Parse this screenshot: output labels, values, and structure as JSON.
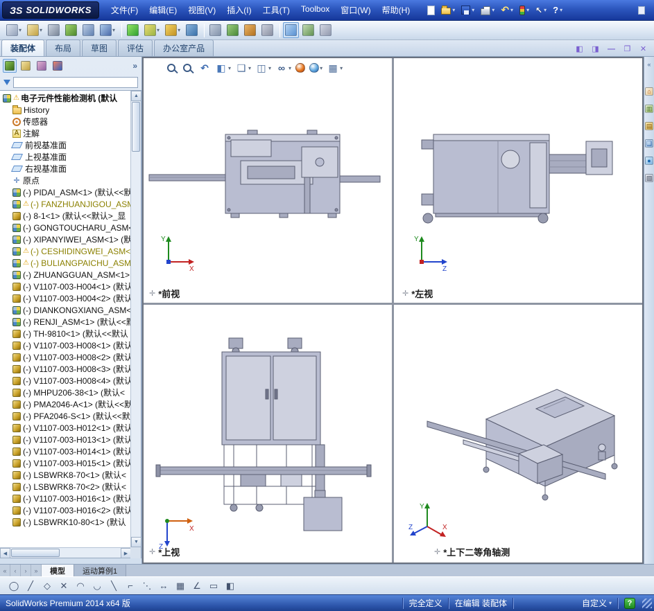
{
  "colors": {
    "accent": "#2f62c4",
    "olive": "#8b8000",
    "titlebar": "#2c56bd",
    "status_green": "#1e8a1e",
    "model_fill": "#b9bdd1",
    "model_stroke": "#5a5e72"
  },
  "icons": {
    "caret": "▾",
    "chevron": "»",
    "taskpane_chevron": "«",
    "view_axis_glyph": "✛",
    "annot_glyph": "A",
    "origin_glyph": "✛",
    "warning_glyph": "⚠",
    "up_arrow": "▲",
    "down_arrow": "▼",
    "left_arrow": "◀",
    "right_arrow": "▶"
  },
  "axes": {
    "x": "X",
    "y": "Y",
    "z": "Z"
  },
  "titlebar": {
    "logo_mark": "ЗS",
    "logo_text": "SOLIDWORKS",
    "menus": [
      {
        "id": "file",
        "label": "文件(F)"
      },
      {
        "id": "edit",
        "label": "编辑(E)"
      },
      {
        "id": "view",
        "label": "视图(V)"
      },
      {
        "id": "insert",
        "label": "插入(I)"
      },
      {
        "id": "tools",
        "label": "工具(T)"
      },
      {
        "id": "toolbox",
        "label": "Toolbox"
      },
      {
        "id": "window",
        "label": "窗口(W)"
      },
      {
        "id": "help",
        "label": "帮助(H)"
      }
    ],
    "quick_icons": [
      {
        "id": "new"
      },
      {
        "id": "open",
        "dropdown": true
      },
      {
        "id": "save",
        "dropdown": true
      },
      {
        "id": "print",
        "dropdown": true
      },
      {
        "id": "undo",
        "glyph": "↶",
        "dropdown": true
      },
      {
        "id": "rebuild",
        "dropdown": true
      },
      {
        "id": "select",
        "glyph": "↖",
        "dropdown": true
      },
      {
        "id": "help",
        "glyph": "?",
        "dropdown": true
      }
    ]
  },
  "toolbar": {
    "icons": [
      {
        "id": "insert-components",
        "c1": "#dce3ee",
        "c2": "#93a2ba",
        "dropdown": true
      },
      {
        "id": "mate",
        "c1": "#f2e4ac",
        "c2": "#c2a244",
        "dropdown": true
      },
      {
        "id": "smart-fasteners",
        "c1": "#ccd4e0",
        "c2": "#7a8698"
      },
      {
        "id": "linear-component-pattern",
        "c1": "#a4d46e",
        "c2": "#4e8a2e"
      },
      {
        "id": "move-component",
        "c1": "#bccce4",
        "c2": "#6282b2"
      },
      {
        "id": "rotate-component",
        "c1": "#accae9",
        "c2": "#4a6aaa",
        "dropdown": true
      },
      {
        "sep": true
      },
      {
        "id": "selection-filter",
        "c1": "#94e464",
        "c2": "#32a232"
      },
      {
        "id": "assembly-features",
        "c1": "#ecdc74",
        "c2": "#9ab444",
        "dropdown": true
      },
      {
        "id": "reference-geometry",
        "c1": "#f4d464",
        "c2": "#c29224",
        "dropdown": true
      },
      {
        "id": "instant3d",
        "c1": "#8cb4dc",
        "c2": "#3a72aa"
      },
      {
        "sep": true
      },
      {
        "id": "bill-of-materials",
        "c1": "#c4cedc",
        "c2": "#8292aa"
      },
      {
        "id": "exploded-view",
        "c1": "#9ccc7c",
        "c2": "#4a8a3a"
      },
      {
        "id": "interference-detection",
        "c1": "#ecb464",
        "c2": "#b27222"
      },
      {
        "id": "measure",
        "c1": "#ccd0dc",
        "c2": "#8a90a2"
      },
      {
        "sep": true
      },
      {
        "id": "viewport-layout",
        "c1": "#b2d2f2",
        "c2": "#5a92d2",
        "active": true
      },
      {
        "id": "display-settings",
        "c1": "#c2dab2",
        "c2": "#629252"
      },
      {
        "id": "section-tool",
        "c1": "#d2d6e2",
        "c2": "#929aae"
      }
    ]
  },
  "command_tabs": {
    "tabs": [
      {
        "id": "assembly",
        "label": "装配体",
        "active": true
      },
      {
        "id": "layout",
        "label": "布局"
      },
      {
        "id": "sketch",
        "label": "草图"
      },
      {
        "id": "evaluate",
        "label": "评估"
      },
      {
        "id": "office",
        "label": "办公室产品"
      }
    ],
    "window_controls": [
      {
        "id": "pane-left",
        "glyph": "◧"
      },
      {
        "id": "pane-right",
        "glyph": "◨"
      },
      {
        "id": "minimize-window",
        "glyph": "—"
      },
      {
        "id": "restore-window",
        "glyph": "❐"
      },
      {
        "id": "close-window",
        "glyph": "✕"
      }
    ]
  },
  "left_panel": {
    "filter_value": "",
    "manager_tabs": [
      {
        "id": "featuremanager",
        "c1": "#8cc454",
        "c2": "#3a6a1a",
        "active": true
      },
      {
        "id": "propertymanager",
        "c1": "#f2e2a2",
        "c2": "#c2a242"
      },
      {
        "id": "configurationmanager",
        "c1": "#e2b2d2",
        "c2": "#9262a2"
      },
      {
        "id": "displaymanager",
        "c1": "#f28262",
        "c2": "#3262c2"
      }
    ],
    "tree": [
      {
        "icon": "asm",
        "warn": true,
        "root": true,
        "label": "电子元件性能检测机 (默认"
      },
      {
        "icon": "folder",
        "label": "History"
      },
      {
        "icon": "sensor",
        "label": "传感器"
      },
      {
        "icon": "annot",
        "label": "注解"
      },
      {
        "icon": "plane",
        "label": "前视基准面"
      },
      {
        "icon": "plane",
        "label": "上视基准面"
      },
      {
        "icon": "plane",
        "label": "右视基准面"
      },
      {
        "icon": "origin",
        "label": "原点"
      },
      {
        "icon": "asm",
        "label": "(-) PIDAI_ASM<1> (默认<<默"
      },
      {
        "icon": "asm",
        "warn": true,
        "olive": true,
        "label": "(-) FANZHUANJIGOU_ASM"
      },
      {
        "icon": "part",
        "label": "(-) 8-1<1> (默认<<默认>_显"
      },
      {
        "icon": "asm",
        "label": "(-) GONGTOUCHARU_ASM<1"
      },
      {
        "icon": "asm",
        "label": "(-) XIPANYIWEI_ASM<1> (默"
      },
      {
        "icon": "asm",
        "warn": true,
        "olive": true,
        "label": "(-) CESHIDINGWEI_ASM<"
      },
      {
        "icon": "asm",
        "warn": true,
        "olive": true,
        "label": "(-) BULIANGPAICHU_ASM-"
      },
      {
        "icon": "asm",
        "label": "(-) ZHUANGGUAN_ASM<1> (默"
      },
      {
        "icon": "part",
        "label": "(-) V1107-003-H004<1> (默认"
      },
      {
        "icon": "part",
        "label": "(-) V1107-003-H004<2> (默认"
      },
      {
        "icon": "asm",
        "label": "(-) DIANKONGXIANG_ASM<1"
      },
      {
        "icon": "asm",
        "label": "(-) RENJI_ASM<1> (默认<<默"
      },
      {
        "icon": "part",
        "label": "(-) TH-9810<1> (默认<<默认"
      },
      {
        "icon": "part",
        "label": "(-) V1107-003-H008<1> (默认"
      },
      {
        "icon": "part",
        "label": "(-) V1107-003-H008<2> (默认"
      },
      {
        "icon": "part",
        "label": "(-) V1107-003-H008<3> (默认"
      },
      {
        "icon": "part",
        "label": "(-) V1107-003-H008<4> (默认"
      },
      {
        "icon": "part",
        "label": "(-) MHPU206-38<1> (默认<"
      },
      {
        "icon": "part",
        "label": "(-) PMA2046-A<1> (默认<<默"
      },
      {
        "icon": "part",
        "label": "(-) PFA2046-S<1> (默认<<默"
      },
      {
        "icon": "part",
        "label": "(-) V1107-003-H012<1> (默认"
      },
      {
        "icon": "part",
        "label": "(-) V1107-003-H013<1> (默认"
      },
      {
        "icon": "part",
        "label": "(-) V1107-003-H014<1> (默认"
      },
      {
        "icon": "part",
        "label": "(-) V1107-003-H015<1> (默认"
      },
      {
        "icon": "part",
        "label": "(-) LSBWRK8-70<1> (默认<"
      },
      {
        "icon": "part",
        "label": "(-) LSBWRK8-70<2> (默认<"
      },
      {
        "icon": "part",
        "label": "(-) V1107-003-H016<1> (默认"
      },
      {
        "icon": "part",
        "label": "(-) V1107-003-H016<2> (默认"
      },
      {
        "icon": "part",
        "label": "(-) LSBWRK10-80<1> (默认"
      }
    ]
  },
  "heads_up": [
    {
      "id": "zoom-fit",
      "shape": "mag"
    },
    {
      "id": "zoom-area",
      "shape": "mag"
    },
    {
      "id": "previous-view",
      "glyph": "↶",
      "fg": "#3b6ab0"
    },
    {
      "id": "section-view",
      "glyph": "◧",
      "fg": "#4a78b8",
      "dropdown": true
    },
    {
      "id": "view-orientation",
      "glyph": "❑",
      "fg": "#4a6a98",
      "dropdown": true
    },
    {
      "id": "display-style",
      "glyph": "◫",
      "fg": "#4a6a98",
      "dropdown": true
    },
    {
      "id": "hide-show-items",
      "glyph": "∞",
      "fg": "#3a5a88",
      "dropdown": true
    },
    {
      "id": "edit-appearance",
      "shape": "sphere",
      "c1": "#e87820",
      "c2": "#a03808"
    },
    {
      "id": "apply-scene",
      "shape": "sphere",
      "c1": "#60a8e0",
      "c2": "#2858a0",
      "dropdown": true
    },
    {
      "id": "view-settings",
      "glyph": "▦",
      "fg": "#4a6a98",
      "dropdown": true
    }
  ],
  "task_pane": [
    {
      "id": "solidworks-resources",
      "glyph": "⌂",
      "c1": "#f8f0e0",
      "c2": "#e8c890",
      "fg": "#b05818"
    },
    {
      "id": "design-library",
      "glyph": "▥",
      "c1": "#e8f0d8",
      "c2": "#a8c878",
      "fg": "#487028"
    },
    {
      "id": "file-explorer",
      "glyph": "▤",
      "c1": "#f8e8b0",
      "c2": "#d8b050",
      "fg": "#886010"
    },
    {
      "id": "view-palette",
      "glyph": "❏",
      "c1": "#d8e8f8",
      "c2": "#88b0d8",
      "fg": "#2858a0"
    },
    {
      "id": "appearances-scenes",
      "glyph": "●",
      "c1": "#d8ecf8",
      "c2": "#78b0e0",
      "fg": "#1868b0"
    },
    {
      "id": "custom-properties",
      "glyph": "▧",
      "c1": "#e8eaf0",
      "c2": "#b0b8c8",
      "fg": "#505868"
    }
  ],
  "viewports": [
    {
      "id": "front",
      "label": "*前视"
    },
    {
      "id": "left",
      "label": "*左视"
    },
    {
      "id": "top",
      "label": "*上视"
    },
    {
      "id": "isometric",
      "label": "*上下二等角轴测"
    }
  ],
  "bottom": {
    "nav": [
      {
        "id": "first-tab",
        "glyph": "«"
      },
      {
        "id": "prev-tab",
        "glyph": "‹"
      },
      {
        "id": "next-tab",
        "glyph": "›"
      },
      {
        "id": "last-tab",
        "glyph": "»"
      }
    ],
    "model_tabs": [
      {
        "id": "model",
        "label": "模型",
        "active": true
      },
      {
        "id": "motion-study-1",
        "label": "运动算例1",
        "active": false
      }
    ],
    "sketch_icons": [
      {
        "id": "sketch-circle",
        "glyph": "◯"
      },
      {
        "id": "sketch-line",
        "glyph": "╱"
      },
      {
        "id": "sketch-polygon",
        "glyph": "◇"
      },
      {
        "id": "sketch-trim",
        "glyph": "✕"
      },
      {
        "id": "sketch-arc",
        "glyph": "◠"
      },
      {
        "id": "sketch-tangent-arc",
        "glyph": "◡"
      },
      {
        "id": "sketch-centerline",
        "glyph": "╲"
      },
      {
        "id": "sketch-offset",
        "glyph": "⌐"
      },
      {
        "id": "sketch-convert-entities",
        "glyph": "⋱"
      },
      {
        "id": "smart-dimension",
        "glyph": "↔"
      },
      {
        "id": "sketch-grid",
        "glyph": "▦"
      },
      {
        "id": "sketch-angle",
        "glyph": "∠"
      },
      {
        "id": "sketch-rectangle",
        "glyph": "▭"
      },
      {
        "id": "sketch-slot",
        "glyph": "◧"
      }
    ]
  },
  "statusbar": {
    "left": "SolidWorks Premium 2014 x64 版",
    "defined": "完全定义",
    "editing": "在编辑 装配体",
    "custom": "自定义",
    "help_badge": "?"
  }
}
